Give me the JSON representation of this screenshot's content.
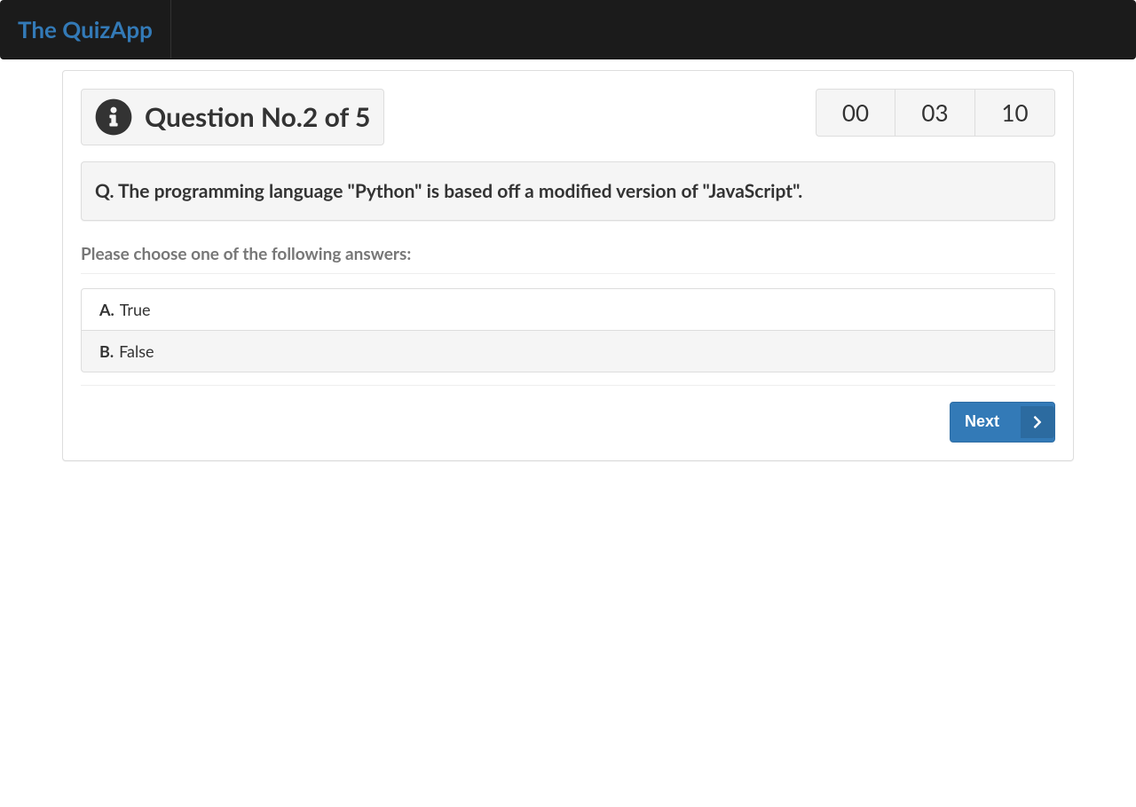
{
  "navbar": {
    "brand": "The QuizApp"
  },
  "header": {
    "question_label": "Question No.2 of 5"
  },
  "timer": {
    "hours": "00",
    "minutes": "03",
    "seconds": "10"
  },
  "question": {
    "prefix": "Q. ",
    "text": "The programming language \"Python\" is based off a modified version of \"JavaScript\"."
  },
  "instruction": "Please choose one of the following answers:",
  "options": [
    {
      "letter": "A.",
      "text": "True"
    },
    {
      "letter": "B.",
      "text": "False"
    }
  ],
  "buttons": {
    "next": "Next"
  }
}
